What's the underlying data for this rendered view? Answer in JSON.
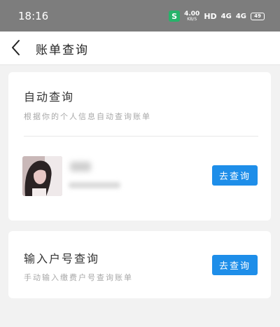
{
  "status_bar": {
    "time": "18:16",
    "shield": "S",
    "speed_value": "4.00",
    "speed_unit": "KB/S",
    "hd": "HD",
    "signal1": "4G",
    "signal2": "4G",
    "battery": "49"
  },
  "nav": {
    "title": "账单查询",
    "back_icon": "chevron-left-icon"
  },
  "auto_query": {
    "title": "自动查询",
    "description": "根据你的个人信息自动查询账单",
    "button_label": "去查询",
    "avatar_icon": "user-avatar-photo"
  },
  "manual_query": {
    "title": "输入户号查询",
    "description": "手动输入缴费户号查询账单",
    "button_label": "去查询"
  },
  "colors": {
    "accent": "#1e8ee9",
    "status_bar": "#7d7d7d",
    "page_background": "#f2f2f2"
  }
}
